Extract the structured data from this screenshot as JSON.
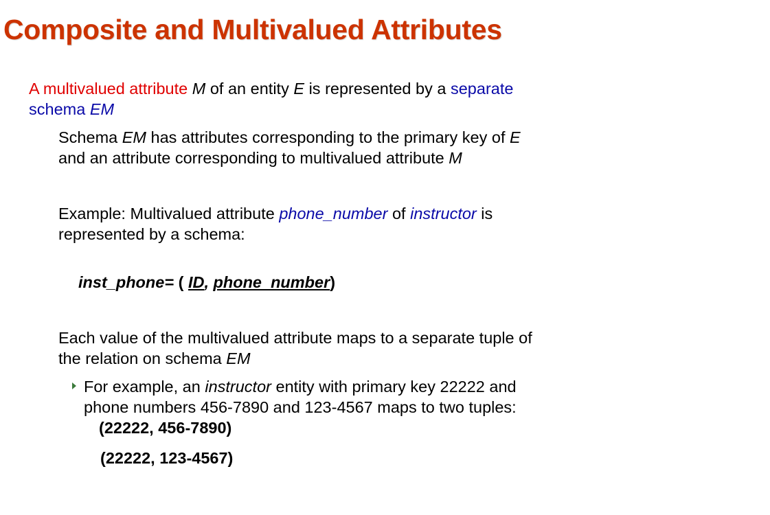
{
  "title": "Composite and Multivalued Attributes",
  "para1": {
    "red_text": "A multivalued attribute",
    "M": "M",
    "t1": "of an entity",
    "E": "E",
    "t2": "is represented by a",
    "blue1": "separate",
    "blue2": "schema",
    "EM": "EM"
  },
  "para2": {
    "t1": "Schema",
    "EM": "EM",
    "t2": "has attributes corresponding to the primary key of",
    "E": "E",
    "t3": "and an attribute corresponding to multivalued attribute",
    "M": "M"
  },
  "example": {
    "t1": "Example:  Multivalued attribute",
    "phone_number": "phone_number",
    "of": "of",
    "instructor": "instructor",
    "is": "is",
    "t2": "represented by a schema:"
  },
  "schema": {
    "name": "inst_phone=",
    "open": "(",
    "id": "ID",
    "comma": ",",
    "phone": "phone_number",
    "close": ")"
  },
  "para3": {
    "t1": "Each value of the multivalued attribute maps to a separate tuple of",
    "t2": "the relation on schema",
    "EM": "EM"
  },
  "sub": {
    "t1": "For example, an",
    "instructor": "instructor",
    "t2": "entity with primary key  22222 and",
    "t3": "phone numbers 456-7890 and 123-4567 maps to two tuples:",
    "tuple1": "(22222, 456-7890)",
    "tuple2": "(22222, 123-4567)"
  }
}
